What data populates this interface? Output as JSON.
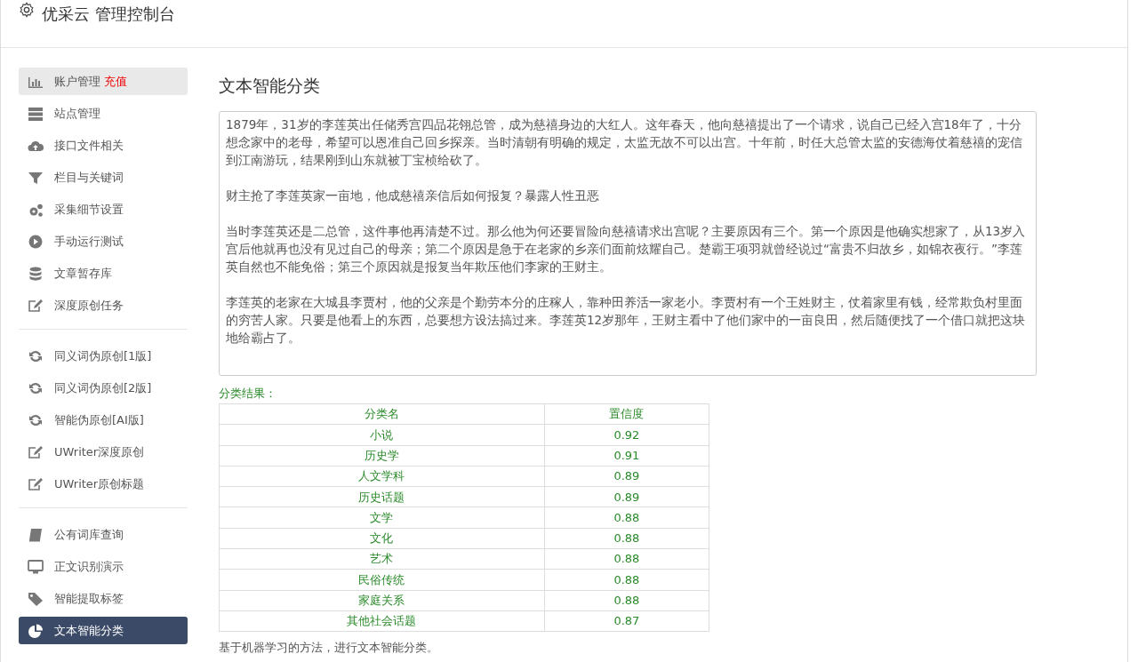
{
  "header": {
    "title": "优采云 管理控制台"
  },
  "sidebar": {
    "groups": [
      {
        "items": [
          {
            "label": "账户管理",
            "badge": "充值",
            "kind": "chart",
            "selected": false,
            "hover": true
          },
          {
            "label": "站点管理",
            "kind": "server",
            "selected": false,
            "hover": false
          },
          {
            "label": "接口文件相关",
            "kind": "cloud",
            "selected": false,
            "hover": false
          },
          {
            "label": "栏目与关键词",
            "kind": "filter",
            "selected": false,
            "hover": false
          },
          {
            "label": "采集细节设置",
            "kind": "gears",
            "selected": false,
            "hover": false
          },
          {
            "label": "手动运行测试",
            "kind": "play",
            "selected": false,
            "hover": false
          },
          {
            "label": "文章暂存库",
            "kind": "database",
            "selected": false,
            "hover": false
          },
          {
            "label": "深度原创任务",
            "kind": "edit",
            "selected": false,
            "hover": false
          }
        ]
      },
      {
        "items": [
          {
            "label": "同义词伪原创[1版]",
            "kind": "refresh",
            "selected": false,
            "hover": false
          },
          {
            "label": "同义词伪原创[2版]",
            "kind": "refresh",
            "selected": false,
            "hover": false
          },
          {
            "label": "智能伪原创[AI版]",
            "kind": "refresh",
            "selected": false,
            "hover": false
          },
          {
            "label": "UWriter深度原创",
            "kind": "edit",
            "selected": false,
            "hover": false
          },
          {
            "label": "UWriter原创标题",
            "kind": "edit",
            "selected": false,
            "hover": false
          }
        ]
      },
      {
        "items": [
          {
            "label": "公有词库查询",
            "kind": "book",
            "selected": false,
            "hover": false
          },
          {
            "label": "正文识别演示",
            "kind": "monitor",
            "selected": false,
            "hover": false
          },
          {
            "label": "智能提取标签",
            "kind": "tag",
            "selected": false,
            "hover": false
          },
          {
            "label": "文本智能分类",
            "kind": "pie",
            "selected": true,
            "hover": false
          }
        ]
      }
    ]
  },
  "main": {
    "heading": "文本智能分类",
    "text_input": {
      "paragraphs": [
        "1879年，31岁的李莲英出任储秀宫四品花翎总管，成为慈禧身边的大红人。这年春天，他向慈禧提出了一个请求，说自己已经入宫18年了，十分想念家中的老母，希望可以恩准自己回乡探亲。当时清朝有明确的规定，太监无故不可以出宫。十年前，时任大总管太监的安德海仗着慈禧的宠信到江南游玩，结果刚到山东就被丁宝桢给砍了。",
        "财主抢了李莲英家一亩地，他成慈禧亲信后如何报复？暴露人性丑恶",
        "当时李莲英还是二总管，这件事他再清楚不过。那么他为何还要冒险向慈禧请求出宫呢？主要原因有三个。第一个原因是他确实想家了，从13岁入宫后他就再也没有见过自己的母亲；第二个原因是急于在老家的乡亲们面前炫耀自己。楚霸王项羽就曾经说过“富贵不归故乡，如锦衣夜行。”李莲英自然也不能免俗；第三个原因就是报复当年欺压他们李家的王财主。",
        "李莲英的老家在大城县李贾村，他的父亲是个勤劳本分的庄稼人，靠种田养活一家老小。李贾村有一个王姓财主，仗着家里有钱，经常欺负村里面的穷苦人家。只要是他看上的东西，总要想方设法搞过来。李莲英12岁那年，王财主看中了他们家中的一亩良田，然后随便找了一个借口就把这块地给霸占了。"
      ]
    },
    "result_label": "分类结果：",
    "table": {
      "columns": [
        "分类名",
        "置信度"
      ],
      "rows": [
        [
          "小说",
          "0.92"
        ],
        [
          "历史学",
          "0.91"
        ],
        [
          "人文学科",
          "0.89"
        ],
        [
          "历史话题",
          "0.89"
        ],
        [
          "文学",
          "0.88"
        ],
        [
          "文化",
          "0.88"
        ],
        [
          "艺术",
          "0.88"
        ],
        [
          "民俗传统",
          "0.88"
        ],
        [
          "家庭关系",
          "0.88"
        ],
        [
          "其他社会话题",
          "0.87"
        ]
      ]
    },
    "note": "基于机器学习的方法，进行文本智能分类。"
  }
}
